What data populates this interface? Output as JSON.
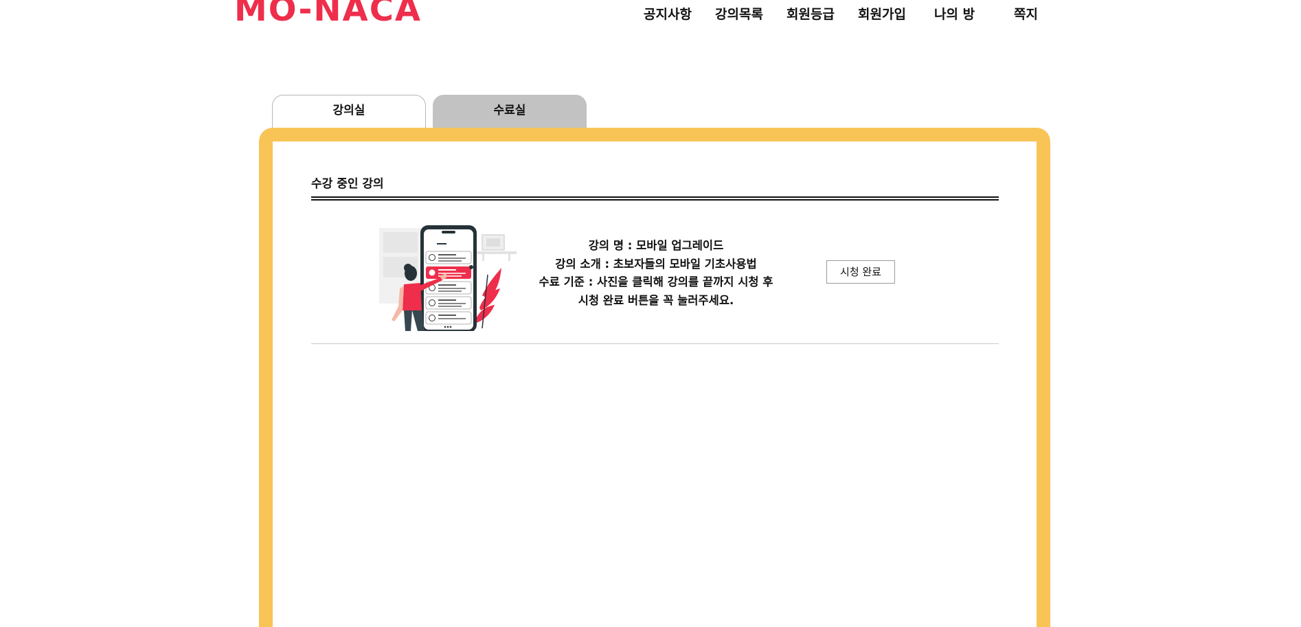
{
  "header": {
    "logo_text": "MO-NACA",
    "nav": [
      {
        "label": "공지사항"
      },
      {
        "label": "강의목록"
      },
      {
        "label": "회원등급"
      },
      {
        "label": "회원가입"
      },
      {
        "label": "나의 방"
      },
      {
        "label": "쪽지"
      }
    ]
  },
  "tabs": [
    {
      "label": "강의실",
      "active": true
    },
    {
      "label": "수료실",
      "active": false
    }
  ],
  "main": {
    "section_title": "수강 중인 강의",
    "courses": [
      {
        "name_line": "강의 명 : 모바일 업그레이드",
        "intro_line": "강의 소개 : 초보자들의 모바일 기초사용법",
        "criteria_line1": "수료 기준 : 사진을 클릭해 강의를 끝까지 시청 후",
        "criteria_line2": "시청 완료 버튼을 꼭 눌러주세요.",
        "button_label": "시청 완료"
      }
    ]
  },
  "colors": {
    "brand": "#ee2e4b",
    "frame": "#f9c456",
    "inactive_tab": "#c2c2c2"
  }
}
